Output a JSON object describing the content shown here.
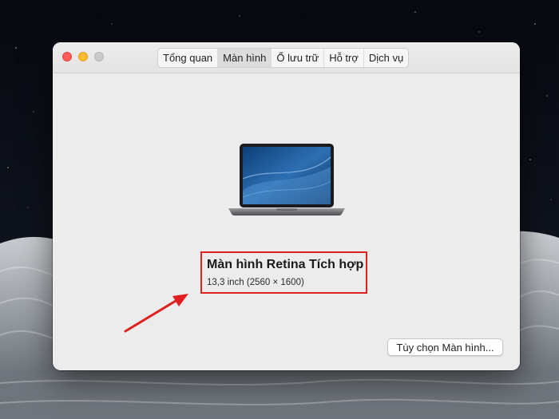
{
  "window": {
    "tabs": [
      {
        "label": "Tổng quan",
        "active": false
      },
      {
        "label": "Màn hình",
        "active": true
      },
      {
        "label": "Ổ lưu trữ",
        "active": false
      },
      {
        "label": "Hỗ trợ",
        "active": false
      },
      {
        "label": "Dịch vụ",
        "active": false
      }
    ],
    "display": {
      "name": "Màn hình Retina Tích hợp",
      "size": "13,3 inch (2560 × 1600)"
    },
    "options_button": "Tùy chọn Màn hình..."
  },
  "colors": {
    "annotation_red": "#e02020",
    "close": "#ff5f57",
    "minimize": "#febc2e",
    "zoom_disabled": "#c9c9c9"
  },
  "icons": [
    "laptop-icon",
    "annotation-arrow-icon"
  ]
}
